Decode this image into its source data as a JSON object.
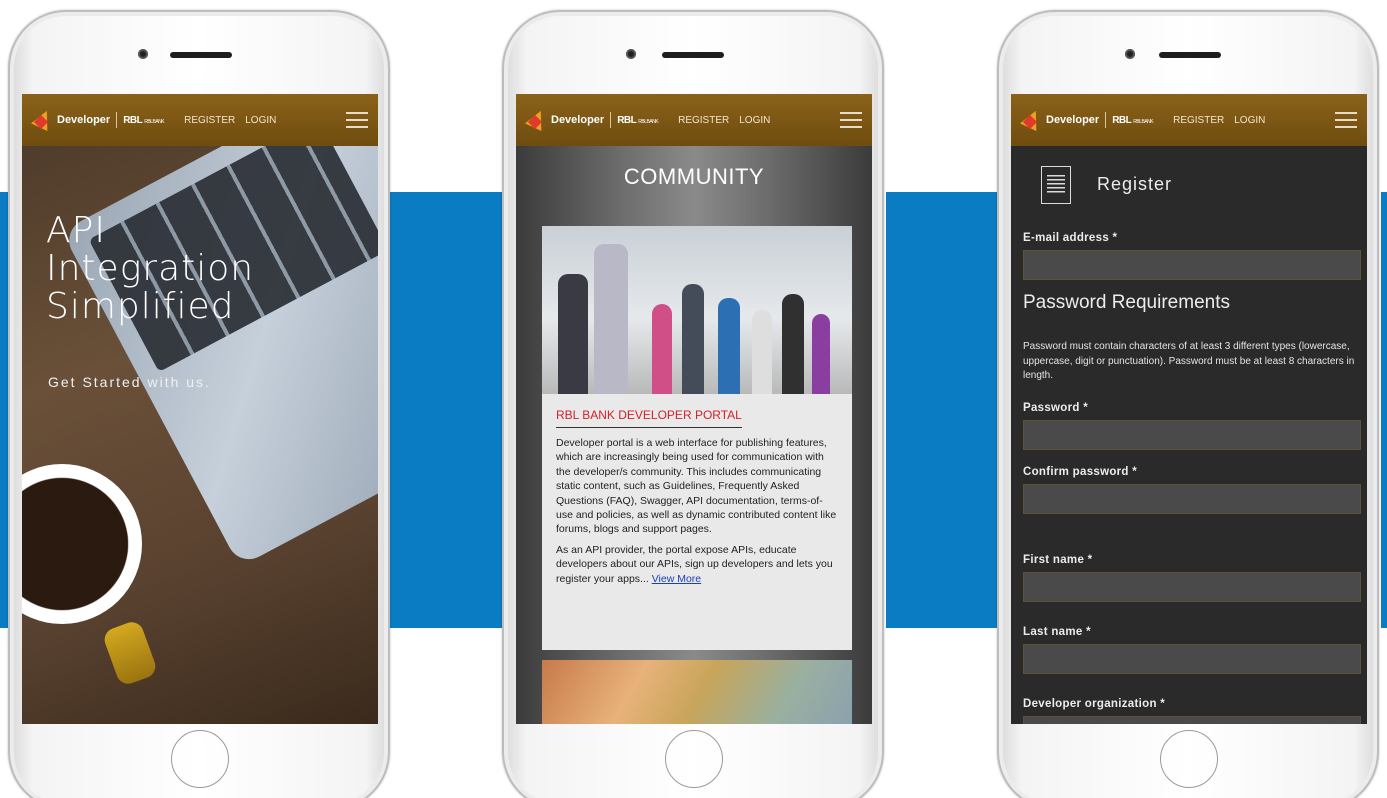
{
  "nav": {
    "brand": "Developer",
    "bank": "RBL",
    "bank_sub": "RBLBANK",
    "register": "REGISTER",
    "login": "LOGIN"
  },
  "home": {
    "title_line1": "API",
    "title_line2": "Integration",
    "title_line3": "Simplified",
    "subtitle": "Get Started with us."
  },
  "community": {
    "title": "COMMUNITY",
    "card_heading": "RBL BANK DEVELOPER PORTAL",
    "paragraph1": "Developer portal is a web interface for publishing features, which are increasingly being used for communication with the developer/s community. This includes communicating static content, such as Guidelines, Frequently Asked Questions (FAQ), Swagger, API documentation, terms-of-use and policies, as well as dynamic contributed content like forums, blogs and support pages.",
    "paragraph2": "As an API provider, the portal expose APIs, educate developers about our APIs, sign up developers and lets you register your apps...",
    "view_more": "View More"
  },
  "register": {
    "title": "Register",
    "email_label": "E-mail address *",
    "requirements_title": "Password Requirements",
    "requirements_text": "Password must contain characters of at least 3 different types (lowercase, uppercase, digit or punctuation). Password must be at least 8 characters in length.",
    "password_label": "Password *",
    "confirm_label": "Confirm password *",
    "first_name_label": "First name *",
    "last_name_label": "Last name *",
    "org_label": "Developer organization *"
  },
  "colors": {
    "band": "#0a7cc4",
    "nav_gold": "#7d5713",
    "heading_red": "#d6202a",
    "link_blue": "#1a3ec8"
  }
}
